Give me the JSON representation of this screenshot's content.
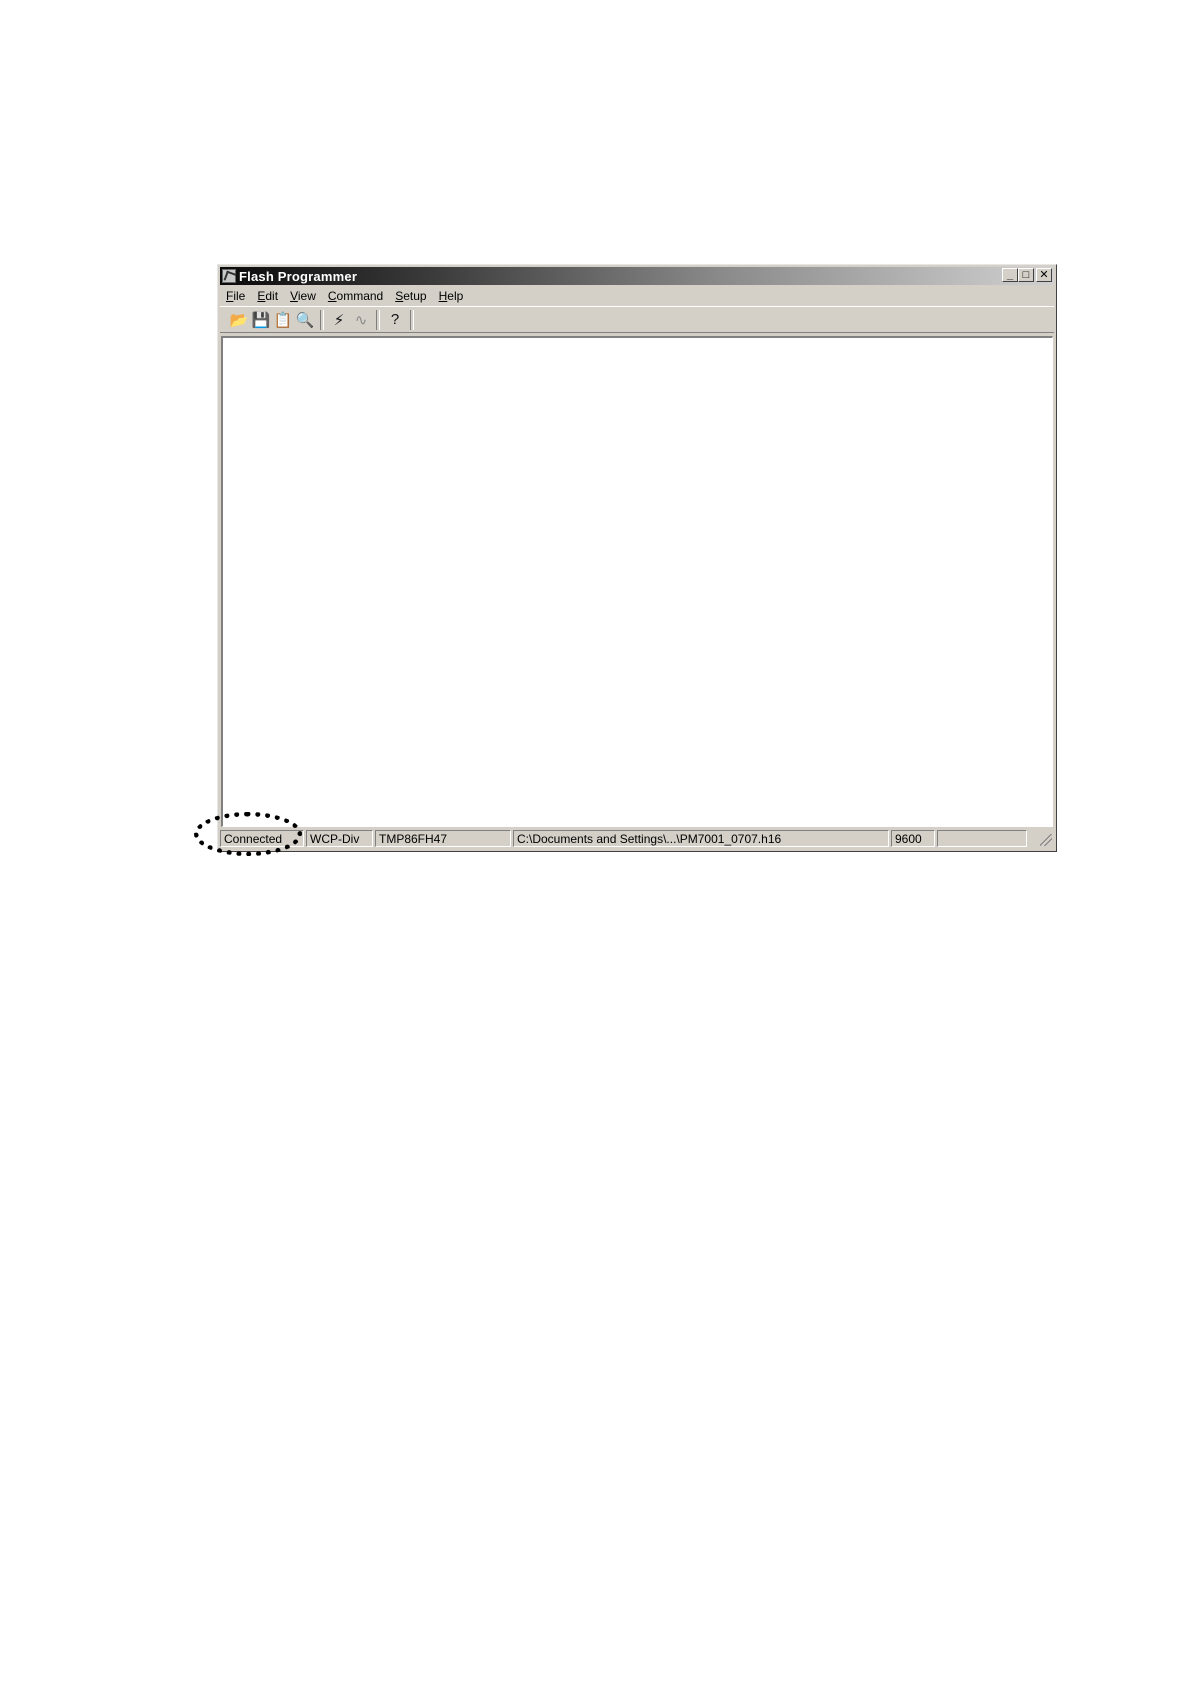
{
  "window": {
    "title": "Flash Programmer",
    "caption": {
      "minimize": "_",
      "maximize": "□",
      "close": "✕"
    }
  },
  "menubar": {
    "items": [
      {
        "label": "File",
        "u": "F",
        "rest": "ile"
      },
      {
        "label": "Edit",
        "u": "E",
        "rest": "dit"
      },
      {
        "label": "View",
        "u": "V",
        "rest": "iew"
      },
      {
        "label": "Command",
        "u": "C",
        "rest": "ommand"
      },
      {
        "label": "Setup",
        "u": "S",
        "rest": "etup"
      },
      {
        "label": "Help",
        "u": "H",
        "rest": "elp"
      }
    ]
  },
  "toolbar": {
    "icons": {
      "open": "📂",
      "save": "💾",
      "properties": "📋",
      "view": "🔍",
      "program": "⚡",
      "wave": "∿",
      "help": "?"
    }
  },
  "statusbar": {
    "connection": "Connected",
    "mode": "WCP-Div",
    "device": "TMP86FH47",
    "file": "C:\\Documents and Settings\\...\\PM7001_0707.h16",
    "baud": "9600",
    "extra": ""
  }
}
